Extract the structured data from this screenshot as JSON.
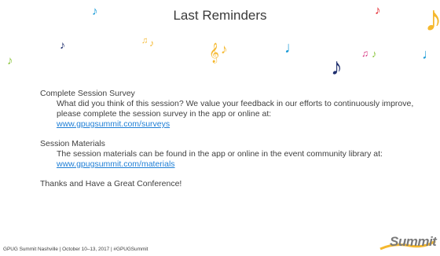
{
  "slide": {
    "title": "Last Reminders",
    "sections": [
      {
        "heading": "Complete Session Survey",
        "body": "What did you think of this session? We value your feedback in our efforts to continuously improve, please complete the session survey in the app or online at:",
        "link": "www.gpugsummit.com/surveys"
      },
      {
        "heading": "Session Materials",
        "body": "The session materials can be found in the app or online in the event community library at:",
        "link": "www.gpugsummit.com/materials"
      }
    ],
    "closing": "Thanks and Have a Great Conference!"
  },
  "footer": {
    "text": "GPUG Summit Nashville | October 10–13, 2017 | #GPUGSummit"
  },
  "logo": {
    "word": "Summit"
  },
  "decor": {
    "icons": [
      "eighth-note-icon",
      "beamed-notes-icon",
      "treble-clef-icon"
    ],
    "colors": {
      "blue": "#1a9bd7",
      "navy": "#1f2f6e",
      "yellow": "#f5b82e",
      "red": "#e3262d",
      "green": "#8cc63f",
      "pink": "#d62c7c"
    }
  }
}
